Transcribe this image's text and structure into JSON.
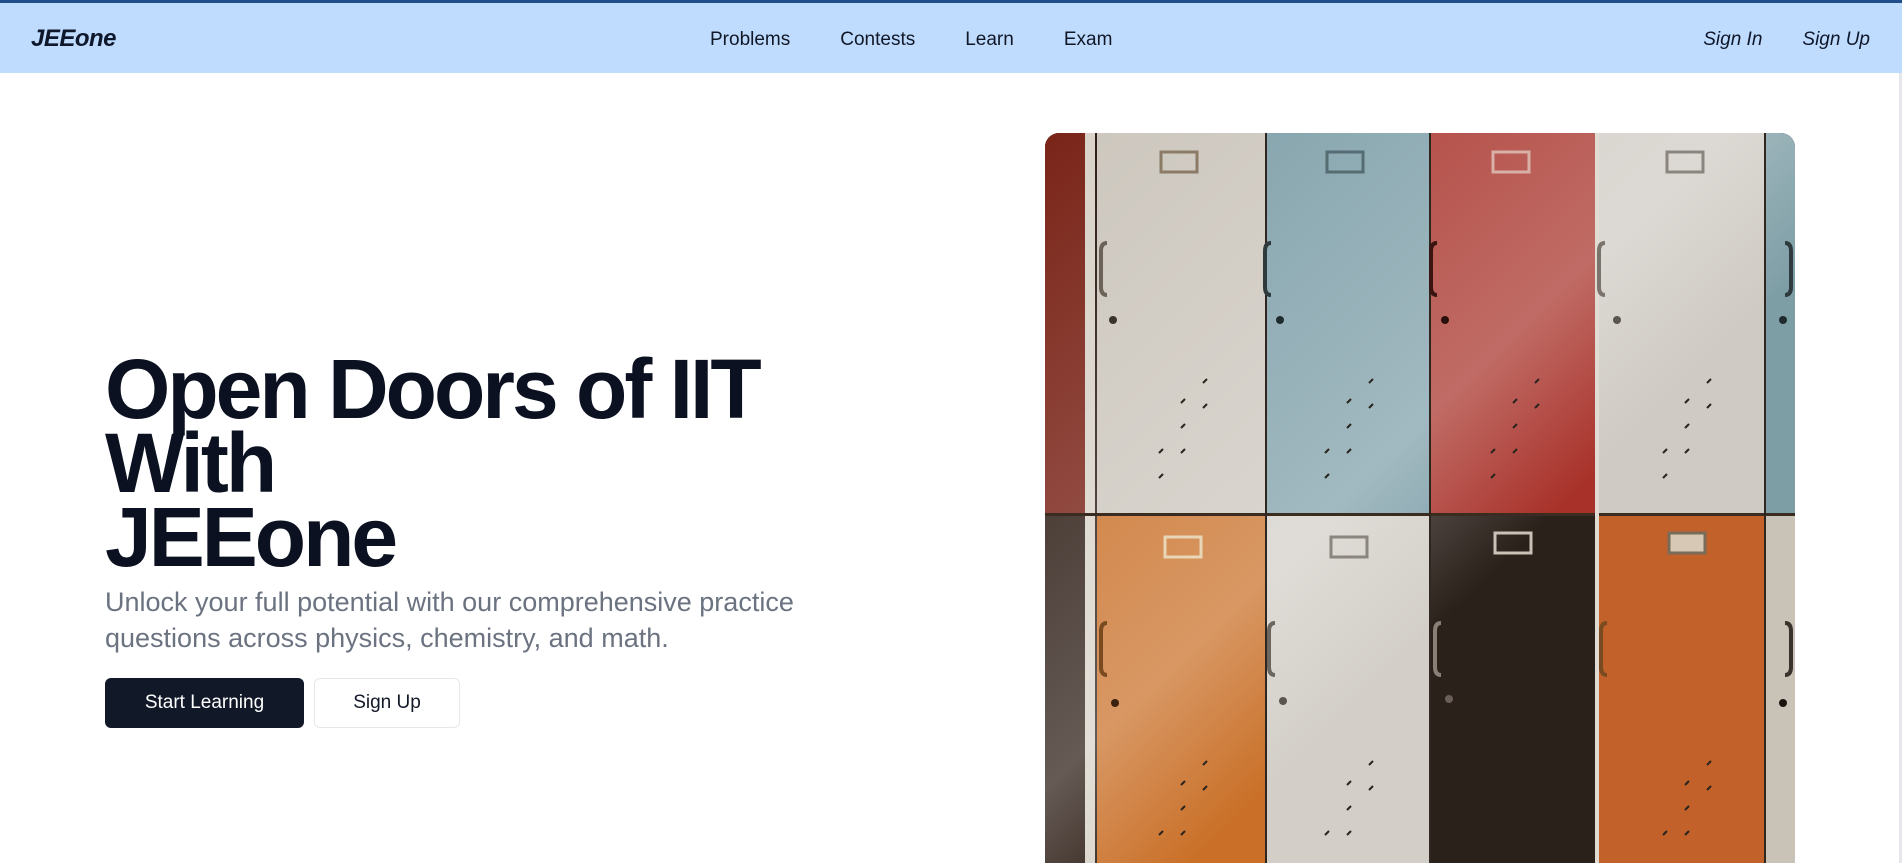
{
  "header": {
    "logo": "JEEone",
    "nav": [
      "Problems",
      "Contests",
      "Learn",
      "Exam"
    ],
    "sign_in": "Sign In",
    "sign_up": "Sign Up"
  },
  "hero": {
    "title_line1": "Open Doors of IIT With",
    "title_line2": "JEEone",
    "subtitle": "Unlock your full potential with our comprehensive practice questions across physics, chemistry, and math.",
    "primary_button": "Start Learning",
    "secondary_button": "Sign Up",
    "image_subject": "colorful-lockers-photo"
  },
  "colors": {
    "nav_bg": "#bfdbfe",
    "accent_line": "#1e4e8c",
    "primary_button": "#111827",
    "title": "#0b1120",
    "subtitle": "#6b7280"
  }
}
